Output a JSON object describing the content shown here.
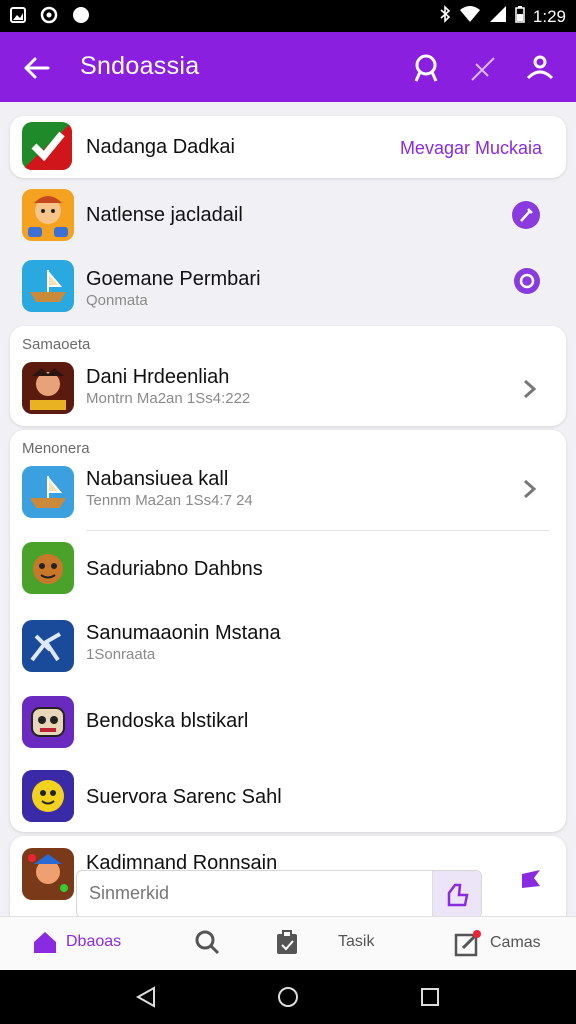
{
  "status_bar": {
    "time": "1:29"
  },
  "app_bar": {
    "title": "Sndoassia"
  },
  "top_card": {
    "title": "Nadanga Dadkai",
    "action": "Mevagar Muckaia"
  },
  "top_list": [
    {
      "title": "Natlense jacladail"
    },
    {
      "title": "Goemane Permbari",
      "subtitle": "Qonmata"
    }
  ],
  "section1": {
    "label": "Samaoeta",
    "item": {
      "title": "Dani Hrdeenliah",
      "subtitle": "Montrn Ma2an 1Ss4:222"
    }
  },
  "section2": {
    "label": "Menonera",
    "items": [
      {
        "title": "Nabansiuea kall",
        "subtitle": "Tennm Ma2an 1Ss4:7 24"
      },
      {
        "title": "Saduriabno Dahbns"
      },
      {
        "title": "Sanumaaonin Mstana",
        "subtitle": "1Sonraata"
      },
      {
        "title": "Bendoska blstikarl"
      },
      {
        "title": "Suervora Sarenc Sahl"
      }
    ]
  },
  "bottom_item": {
    "title": "Kadimnand Ronnsain"
  },
  "search": {
    "placeholder": "Sinmerkid"
  },
  "bottom_nav": [
    {
      "label": "Dbaoas",
      "icon": "home-icon"
    },
    {
      "label": "",
      "icon": "search-icon"
    },
    {
      "label": "",
      "icon": "clipboard-icon"
    },
    {
      "label": "Tasik",
      "icon": ""
    },
    {
      "label": "Camas",
      "icon": "edit-icon"
    }
  ],
  "colors": {
    "primary": "#8a1fe0",
    "accent": "#8a3be0",
    "link": "#8a2be2"
  }
}
